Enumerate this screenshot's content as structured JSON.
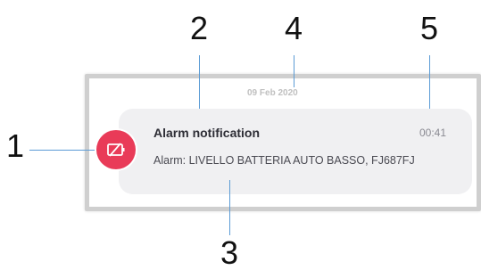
{
  "callouts": {
    "c1": "1",
    "c2": "2",
    "c3": "3",
    "c4": "4",
    "c5": "5"
  },
  "notification": {
    "date": "09 Feb 2020",
    "title": "Alarm notification",
    "time": "00:41",
    "message": "Alarm: LIVELLO BATTERIA AUTO BASSO, FJ687FJ",
    "icon": "battery-off-icon",
    "icon_color": "#e93b58"
  },
  "colors": {
    "leader_line": "#5b9bd5",
    "bubble_bg": "#f0f0f2",
    "card_border": "#cfcfcf"
  }
}
